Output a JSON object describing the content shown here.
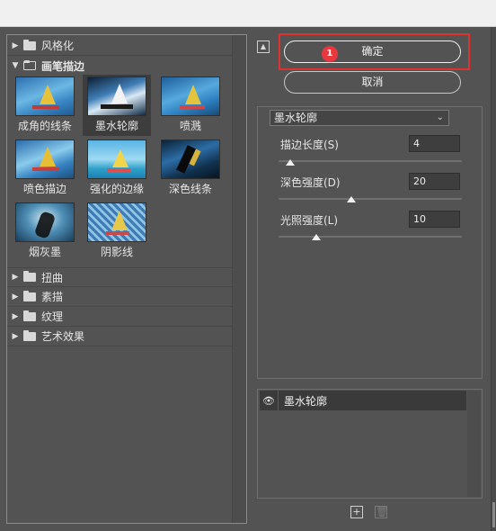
{
  "filter_tree": {
    "folders_top": [
      {
        "label": "风格化",
        "expanded": false
      }
    ],
    "open_folder": {
      "label": "画笔描边",
      "expanded": true
    },
    "filters": [
      {
        "label": "成角的线条",
        "selected": false
      },
      {
        "label": "墨水轮廓",
        "selected": true
      },
      {
        "label": "喷溅",
        "selected": false
      },
      {
        "label": "喷色描边",
        "selected": false
      },
      {
        "label": "强化的边缘",
        "selected": false
      },
      {
        "label": "深色线条",
        "selected": false
      },
      {
        "label": "烟灰墨",
        "selected": false
      },
      {
        "label": "阴影线",
        "selected": false
      }
    ],
    "folders_bottom": [
      {
        "label": "扭曲"
      },
      {
        "label": "素描"
      },
      {
        "label": "纹理"
      },
      {
        "label": "艺术效果"
      }
    ]
  },
  "buttons": {
    "ok_label": "确定",
    "cancel_label": "取消",
    "badge_number": "1"
  },
  "settings": {
    "filter_select": "墨水轮廓",
    "params": [
      {
        "label": "描边长度(S)",
        "value": "4",
        "slider": 0.08
      },
      {
        "label": "深色强度(D)",
        "value": "20",
        "slider": 0.4
      },
      {
        "label": "光照强度(L)",
        "value": "10",
        "slider": 0.2
      }
    ]
  },
  "layers": {
    "items": [
      {
        "label": "墨水轮廓",
        "visible": true
      }
    ]
  },
  "icons": {
    "collapse": "collapse-icon",
    "eye": "eye-icon",
    "new_layer": "new-layer-icon",
    "delete_layer": "trash-icon"
  },
  "colors": {
    "panel_bg": "#535353",
    "highlight_border": "#e03030",
    "badge_bg": "#e8383d"
  }
}
